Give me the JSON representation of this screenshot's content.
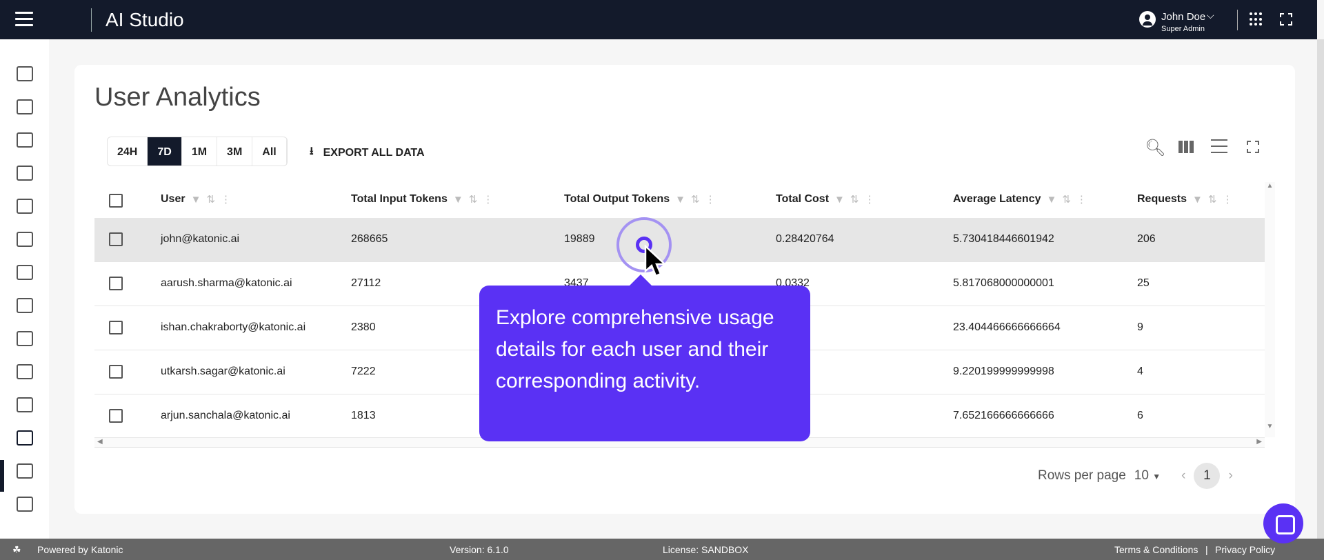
{
  "header": {
    "app_title": "AI Studio",
    "user_name": "John Doe",
    "user_role": "Super Admin"
  },
  "sidebar": {
    "items": [
      "dashboard",
      "chip",
      "learning",
      "briefcase",
      "toolbox",
      "video-settings",
      "brain",
      "monitor",
      "apps-link",
      "sliders",
      "user-settings",
      "user-analytics",
      "store",
      "admin-settings"
    ],
    "active": "user-analytics"
  },
  "page": {
    "title": "User Analytics",
    "ranges": [
      "24H",
      "7D",
      "1M",
      "3M",
      "All"
    ],
    "selected_range": "7D",
    "export_label": "EXPORT ALL DATA"
  },
  "table": {
    "columns": [
      "User",
      "Total Input Tokens",
      "Total Output Tokens",
      "Total Cost",
      "Average Latency",
      "Requests"
    ],
    "rows": [
      {
        "user": "john@katonic.ai",
        "input": "268665",
        "output": "19889",
        "cost": "0.28420764",
        "latency": "5.730418446601942",
        "requests": "206"
      },
      {
        "user": "aarush.sharma@katonic.ai",
        "input": "27112",
        "output": "3437",
        "cost": "0.0332",
        "latency": "5.817068000000001",
        "requests": "25"
      },
      {
        "user": "ishan.chakraborty@katonic.ai",
        "input": "2380",
        "latency": "23.404466666666664",
        "requests": "9"
      },
      {
        "user": "utkarsh.sagar@katonic.ai",
        "input": "7222",
        "latency": "9.220199999999998",
        "requests": "4"
      },
      {
        "user": "arjun.sanchala@katonic.ai",
        "input": "1813",
        "latency": "7.652166666666666",
        "requests": "6"
      }
    ]
  },
  "pagination": {
    "rows_per_page_label": "Rows per page",
    "rows_per_page": "10",
    "current_page": "1"
  },
  "tooltip": {
    "text": "Explore comprehensive usage details for each user and their corresponding activity."
  },
  "footer": {
    "powered_by": "Powered by Katonic",
    "version": "Version: 6.1.0",
    "license": "License: SANDBOX",
    "terms": "Terms & Conditions",
    "separator": "|",
    "privacy": "Privacy Policy"
  },
  "colors": {
    "header_bg": "#131a2b",
    "accent": "#5a31f4",
    "footer_bg": "#666666"
  }
}
